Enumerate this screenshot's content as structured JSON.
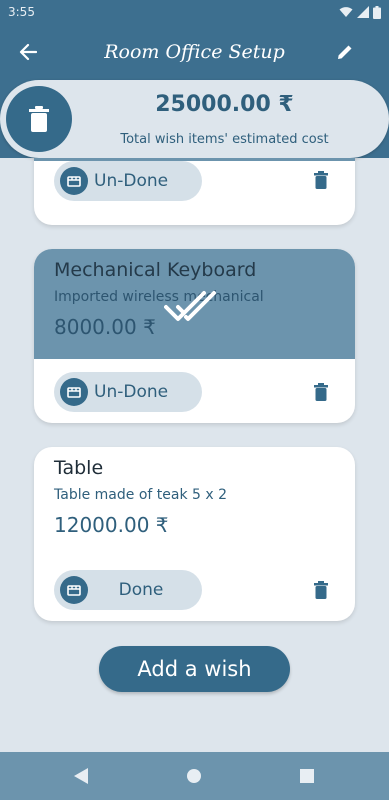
{
  "status_bar": {
    "time": "3:55"
  },
  "app_bar": {
    "title": "Room Office Setup"
  },
  "summary": {
    "total": "25000.00 ₹",
    "caption": "Total wish items' estimated cost"
  },
  "wishes": [
    {
      "name": "",
      "description": "",
      "price": "",
      "toggle_label": "Un-Done",
      "done": true
    },
    {
      "name": "Mechanical Keyboard",
      "description": "Imported wireless mechanical",
      "price": "8000.00 ₹",
      "toggle_label": "Un-Done",
      "done": true
    },
    {
      "name": "Table",
      "description": "Table made of teak 5 x 2",
      "price": "12000.00 ₹",
      "toggle_label": "Done",
      "done": false
    }
  ],
  "actions": {
    "add_wish": "Add a wish"
  },
  "colors": {
    "primary": "#356a8a",
    "app_bar": "#3d6f8f",
    "background": "#dde5ec",
    "done_card": "#6c94ad"
  }
}
